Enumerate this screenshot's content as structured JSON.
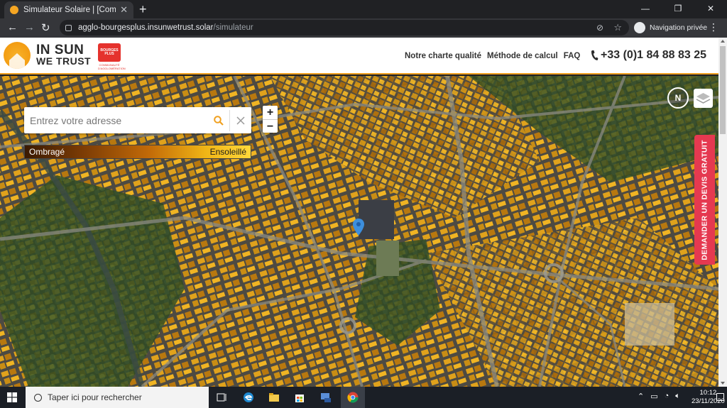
{
  "browser": {
    "tab_title": "Simulateur Solaire | [Communauté",
    "url_host": "agglo-bourgesplus.insunwetrust.solar",
    "url_path": "/simulateur",
    "private_label": "Navigation privée"
  },
  "site": {
    "brand_line1": "IN SUN",
    "brand_line2": "WE TRUST",
    "partner_name": "BOURGES PLUS",
    "partner_sub": "COMMUNAUTÉ D'AGGLOMÉRATION",
    "nav": [
      "Notre charte qualité",
      "Méthode de calcul",
      "FAQ"
    ],
    "phone": "+33 (0)1 84 88 83 25"
  },
  "map": {
    "search_placeholder": "Entrez votre adresse",
    "zoom_in": "+",
    "zoom_out": "−",
    "legend_left": "Ombragé",
    "legend_right": "Ensoleillé",
    "compass_label": "N",
    "cta_label": "DEMANDER UN DEVIS GRATUIT",
    "colors": {
      "shaded": "#3a1a02",
      "sunny": "#ffd83a",
      "cta": "#e53950",
      "accent": "#f0a020"
    }
  },
  "taskbar": {
    "search_placeholder": "Taper ici pour rechercher",
    "time": "10:12",
    "date": "23/11/2020"
  }
}
